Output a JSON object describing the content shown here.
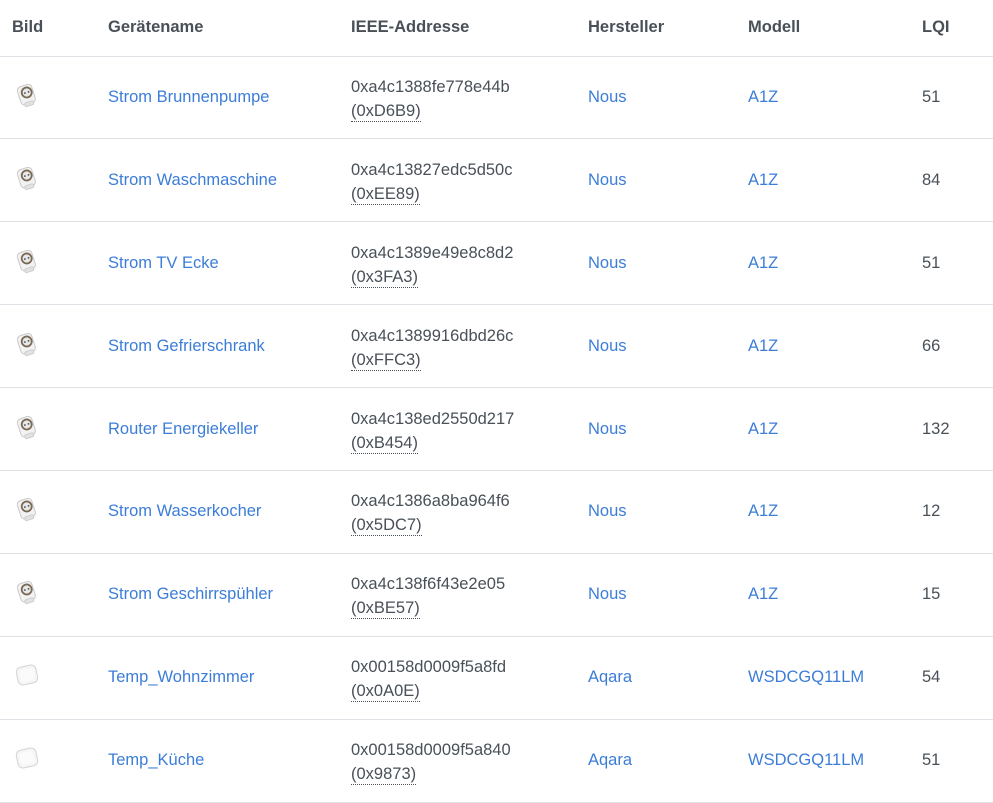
{
  "table": {
    "headers": {
      "bild": "Bild",
      "name": "Gerätename",
      "ieee": "IEEE-Addresse",
      "hersteller": "Hersteller",
      "modell": "Modell",
      "lqi": "LQI"
    },
    "rows": [
      {
        "icon": "smart-plug-icon",
        "name": "Strom Brunnenpumpe",
        "ieee": "0xa4c1388fe778e44b",
        "nwk": "(0xD6B9)",
        "hersteller": "Nous",
        "modell": "A1Z",
        "lqi": "51"
      },
      {
        "icon": "smart-plug-icon",
        "name": "Strom Waschmaschine",
        "ieee": "0xa4c13827edc5d50c",
        "nwk": "(0xEE89)",
        "hersteller": "Nous",
        "modell": "A1Z",
        "lqi": "84"
      },
      {
        "icon": "smart-plug-icon",
        "name": "Strom TV Ecke",
        "ieee": "0xa4c1389e49e8c8d2",
        "nwk": "(0x3FA3)",
        "hersteller": "Nous",
        "modell": "A1Z",
        "lqi": "51"
      },
      {
        "icon": "smart-plug-icon",
        "name": "Strom Gefrierschrank",
        "ieee": "0xa4c1389916dbd26c",
        "nwk": "(0xFFC3)",
        "hersteller": "Nous",
        "modell": "A1Z",
        "lqi": "66"
      },
      {
        "icon": "smart-plug-icon",
        "name": "Router Energiekeller",
        "ieee": "0xa4c138ed2550d217",
        "nwk": "(0xB454)",
        "hersteller": "Nous",
        "modell": "A1Z",
        "lqi": "132"
      },
      {
        "icon": "smart-plug-icon",
        "name": "Strom Wasserkocher",
        "ieee": "0xa4c1386a8ba964f6",
        "nwk": "(0x5DC7)",
        "hersteller": "Nous",
        "modell": "A1Z",
        "lqi": "12"
      },
      {
        "icon": "smart-plug-icon",
        "name": "Strom Geschirrspühler",
        "ieee": "0xa4c138f6f43e2e05",
        "nwk": "(0xBE57)",
        "hersteller": "Nous",
        "modell": "A1Z",
        "lqi": "15"
      },
      {
        "icon": "temperature-sensor-icon",
        "name": "Temp_Wohnzimmer",
        "ieee": "0x00158d0009f5a8fd",
        "nwk": "(0x0A0E)",
        "hersteller": "Aqara",
        "modell": "WSDCGQ11LM",
        "lqi": "54"
      },
      {
        "icon": "temperature-sensor-icon",
        "name": "Temp_Küche",
        "ieee": "0x00158d0009f5a840",
        "nwk": "(0x9873)",
        "hersteller": "Aqara",
        "modell": "WSDCGQ11LM",
        "lqi": "51"
      }
    ]
  },
  "colors": {
    "link": "#3c7dd8",
    "text": "#495057",
    "border": "#dee2e6"
  }
}
